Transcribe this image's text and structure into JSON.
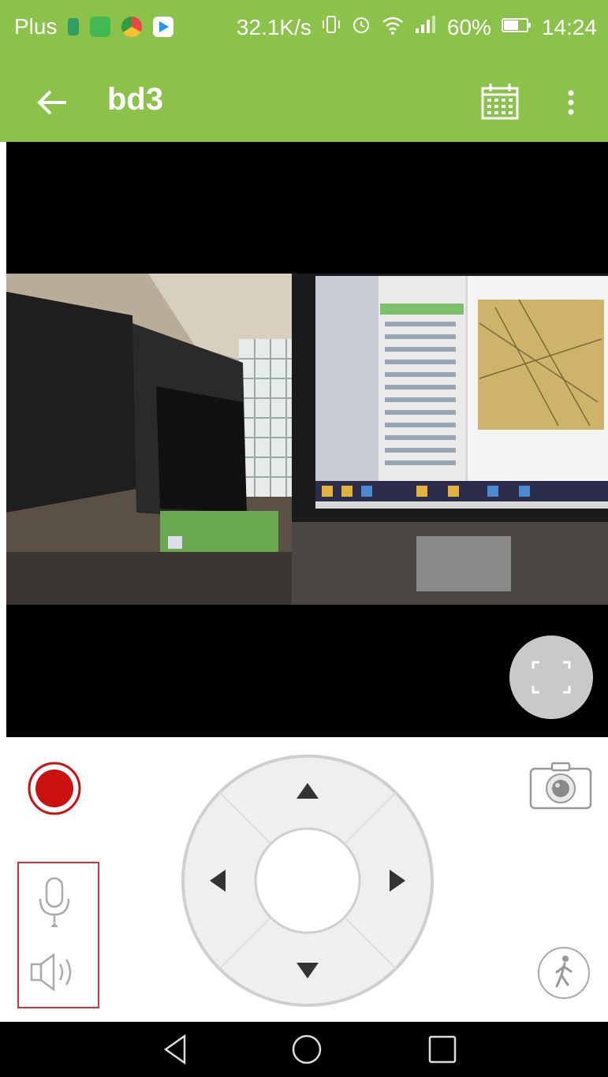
{
  "status_bar": {
    "carrier": "Plus",
    "speed": "32.1K/s",
    "battery": "60%",
    "time": "14:24",
    "icons": [
      "notification-green-icon",
      "notification-shield-icon",
      "chrome-icon",
      "play-store-icon",
      "vibrate-icon",
      "alarm-icon",
      "wifi-icon",
      "signal-icon",
      "battery-icon"
    ]
  },
  "app_bar": {
    "title": "bd3",
    "back_icon": "arrow-left-icon",
    "calendar_icon": "calendar-icon",
    "menu_icon": "more-vert-icon",
    "background": "#8bc34a"
  },
  "video": {
    "fullscreen_icon": "fullscreen-icon"
  },
  "controls": {
    "record_icon": "record-icon",
    "snapshot_icon": "camera-icon",
    "dpad_icons": [
      "arrow-up-icon",
      "arrow-left-icon",
      "arrow-right-icon",
      "arrow-down-icon"
    ],
    "mic_icon": "microphone-icon",
    "speaker_icon": "speaker-icon",
    "motion_icon": "walking-person-icon",
    "record_color": "#cc1111",
    "highlight_color": "#e03030"
  },
  "nav_bar": {
    "icons": [
      "nav-back-icon",
      "nav-home-icon",
      "nav-recents-icon"
    ]
  }
}
